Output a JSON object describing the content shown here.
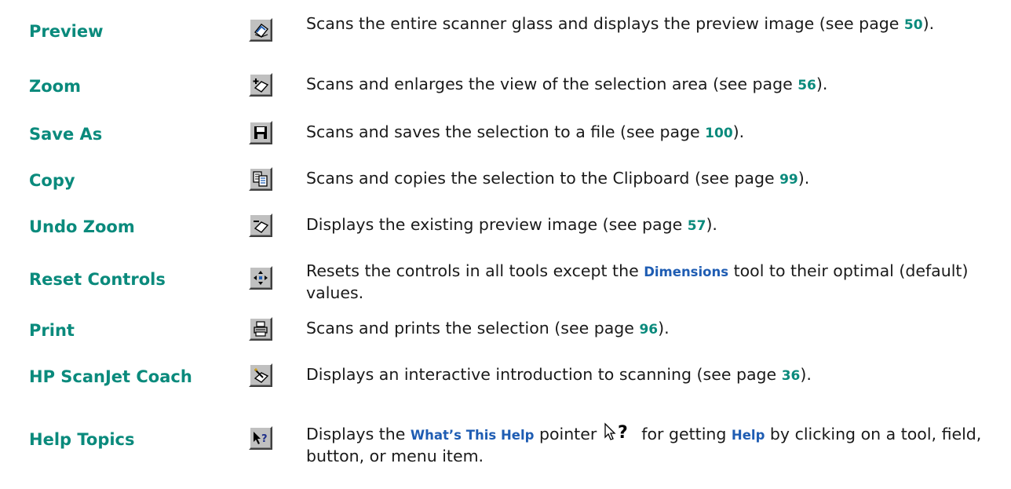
{
  "colors": {
    "term": "#0a8a7c",
    "page_ref": "#0a8a7c",
    "keyword": "#1f5db3",
    "button_face": "#c0c0c0"
  },
  "rows": [
    {
      "term": "Preview",
      "icon": "scanner-preview-icon",
      "desc_a": "Scans the entire scanner glass and displays the preview image (see page ",
      "page": "50",
      "desc_b": ")."
    },
    {
      "term": "Zoom",
      "icon": "zoom-scan-icon",
      "desc_a": "Scans and enlarges the view of the selection area (see page ",
      "page": "56",
      "desc_b": ")."
    },
    {
      "term": "Save As",
      "icon": "floppy-disk-icon",
      "desc_a": "Scans and saves the selection to a file (see page ",
      "page": "100",
      "desc_b": ")."
    },
    {
      "term": "Copy",
      "icon": "copy-icon",
      "desc_a": "Scans and copies the selection to the Clipboard (see page ",
      "page": "99",
      "desc_b": ")."
    },
    {
      "term": "Undo Zoom",
      "icon": "undo-zoom-icon",
      "desc_a": "Displays the existing preview image (see page ",
      "page": "57",
      "desc_b": ")."
    },
    {
      "term": "Reset Controls",
      "icon": "reset-controls-icon",
      "desc_a": "Resets the controls in all tools except the ",
      "keyword": "Dimensions",
      "desc_b": " tool to their optimal (default) values."
    },
    {
      "term": "Print",
      "icon": "printer-icon",
      "desc_a": "Scans and prints the selection (see page ",
      "page": "96",
      "desc_b": ")."
    },
    {
      "term": "HP ScanJet Coach",
      "icon": "coach-wand-icon",
      "desc_a": "Displays an interactive introduction to scanning (see page ",
      "page": "36",
      "desc_b": ")."
    },
    {
      "term": "Help Topics",
      "icon": "whats-this-help-icon",
      "desc_a": "Displays the ",
      "keyword": "What’s This Help",
      "desc_b": " pointer ",
      "pointer_icon": "help-pointer-icon",
      "desc_c": " for getting ",
      "keyword2": "Help",
      "desc_d": " by clicking on a tool, field, button, or menu item."
    }
  ]
}
